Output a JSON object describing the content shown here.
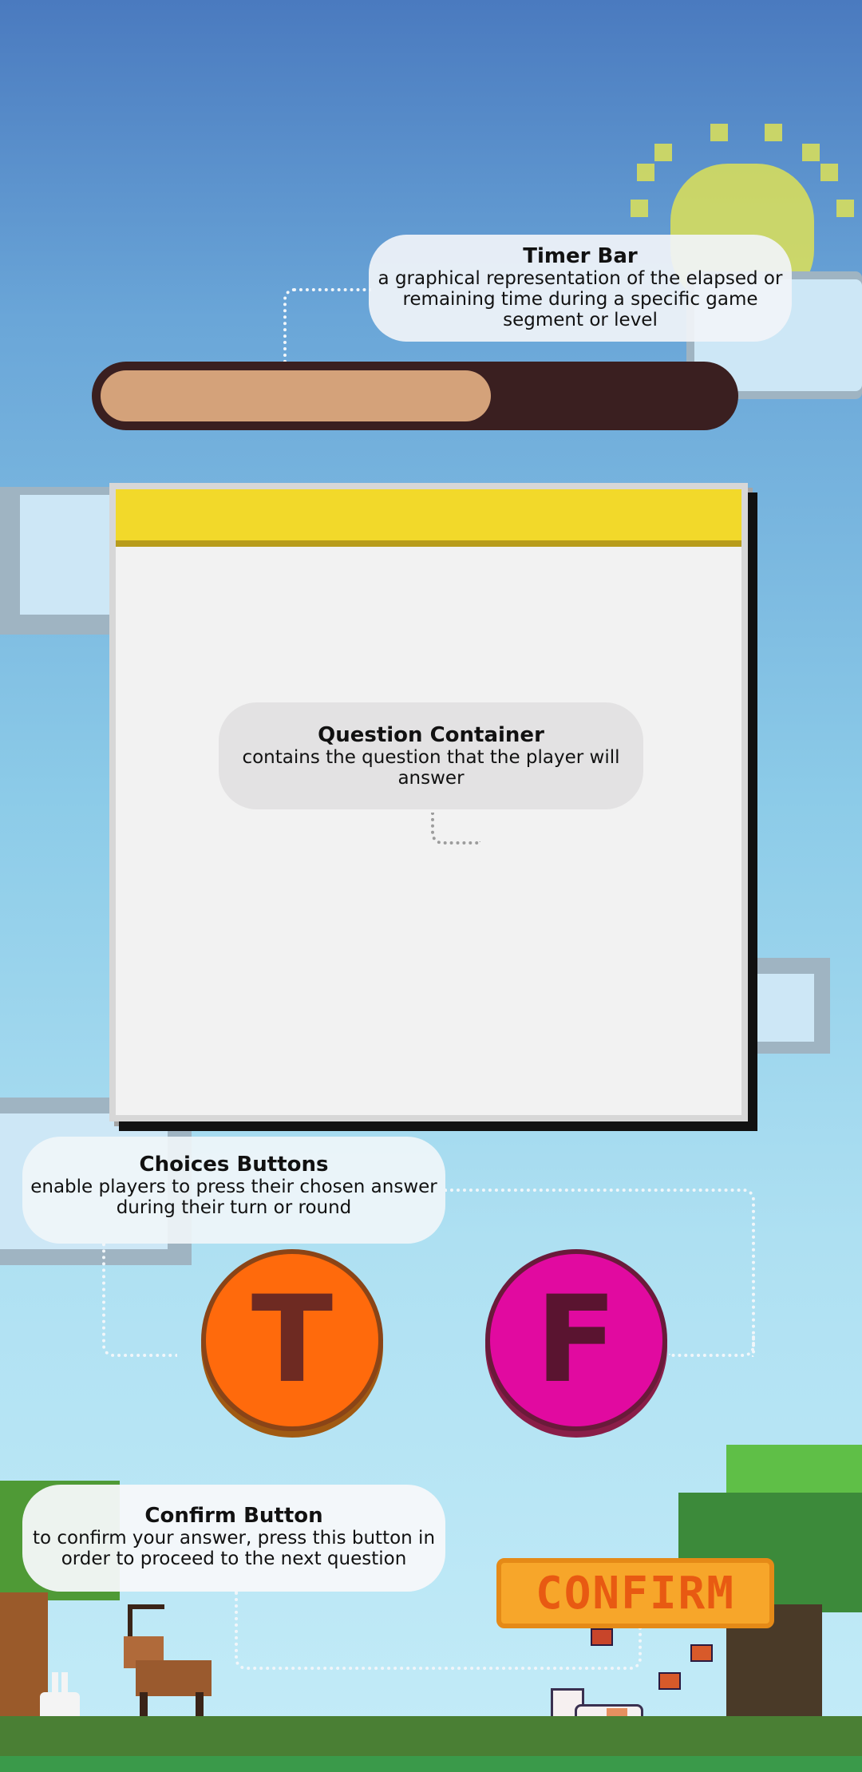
{
  "timer": {
    "progress": 0.62,
    "callout_title": "Timer Bar",
    "callout_text": "a graphical representation of the elapsed or remaining time during a specific game segment or level"
  },
  "question": {
    "callout_title": "Question Container",
    "callout_text": "contains the question that the player will answer"
  },
  "choices": {
    "callout_title": "Choices Buttons",
    "callout_text": "enable players to press their chosen answer during their turn or round",
    "true_label": "T",
    "false_label": "F"
  },
  "confirm": {
    "callout_title": "Confirm Button",
    "callout_text": "to confirm your answer, press this button in order to proceed to the next question",
    "label": "CONFIRM"
  },
  "colors": {
    "timer_fill": "#d4a27a",
    "timer_track": "#3a1f20",
    "card_header": "#f2d92a",
    "true_button": "#ff6a0c",
    "false_button": "#e10aa0",
    "confirm_button": "#f7a62a"
  }
}
